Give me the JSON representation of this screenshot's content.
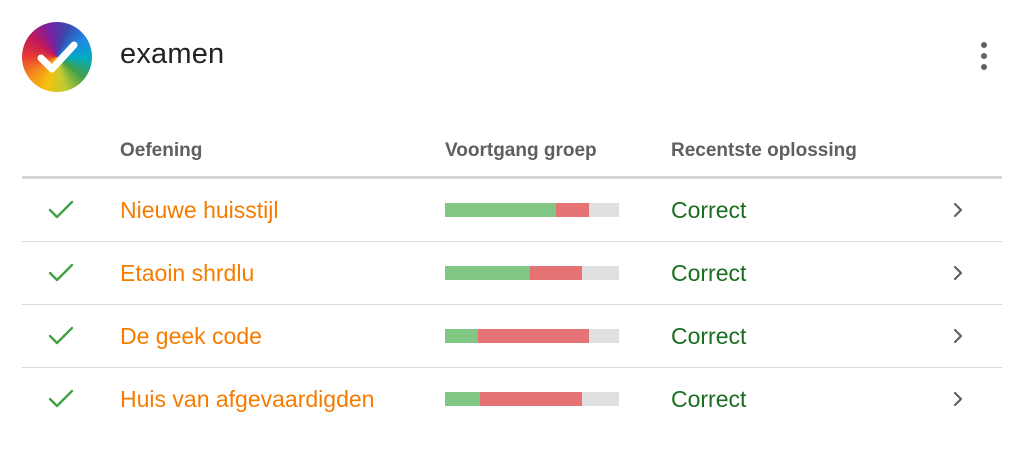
{
  "header": {
    "title": "examen",
    "logo_icon": "rainbow-check-logo",
    "menu_icon": "more-vert-icon"
  },
  "table": {
    "columns": [
      "",
      "Oefening",
      "Voortgang groep",
      "Recentste oplossing",
      ""
    ],
    "rows": [
      {
        "status_icon": "check-icon",
        "exercise": "Nieuwe huisstijl",
        "progress_correct": 0.64,
        "progress_wrong": 0.19,
        "latest_solution": "Correct"
      },
      {
        "status_icon": "check-icon",
        "exercise": "Etaoin shrdlu",
        "progress_correct": 0.49,
        "progress_wrong": 0.3,
        "latest_solution": "Correct"
      },
      {
        "status_icon": "check-icon",
        "exercise": "De geek code",
        "progress_correct": 0.19,
        "progress_wrong": 0.64,
        "latest_solution": "Correct"
      },
      {
        "status_icon": "check-icon",
        "exercise": "Huis van afgevaardigden",
        "progress_correct": 0.2,
        "progress_wrong": 0.59,
        "latest_solution": "Correct"
      }
    ]
  },
  "colors": {
    "exercise_link": "#f57c00",
    "correct_text": "#1b6e20",
    "check": "#43a047",
    "progress_correct": "#81c784",
    "progress_wrong": "#e57373",
    "progress_empty": "#e0e0e0"
  }
}
